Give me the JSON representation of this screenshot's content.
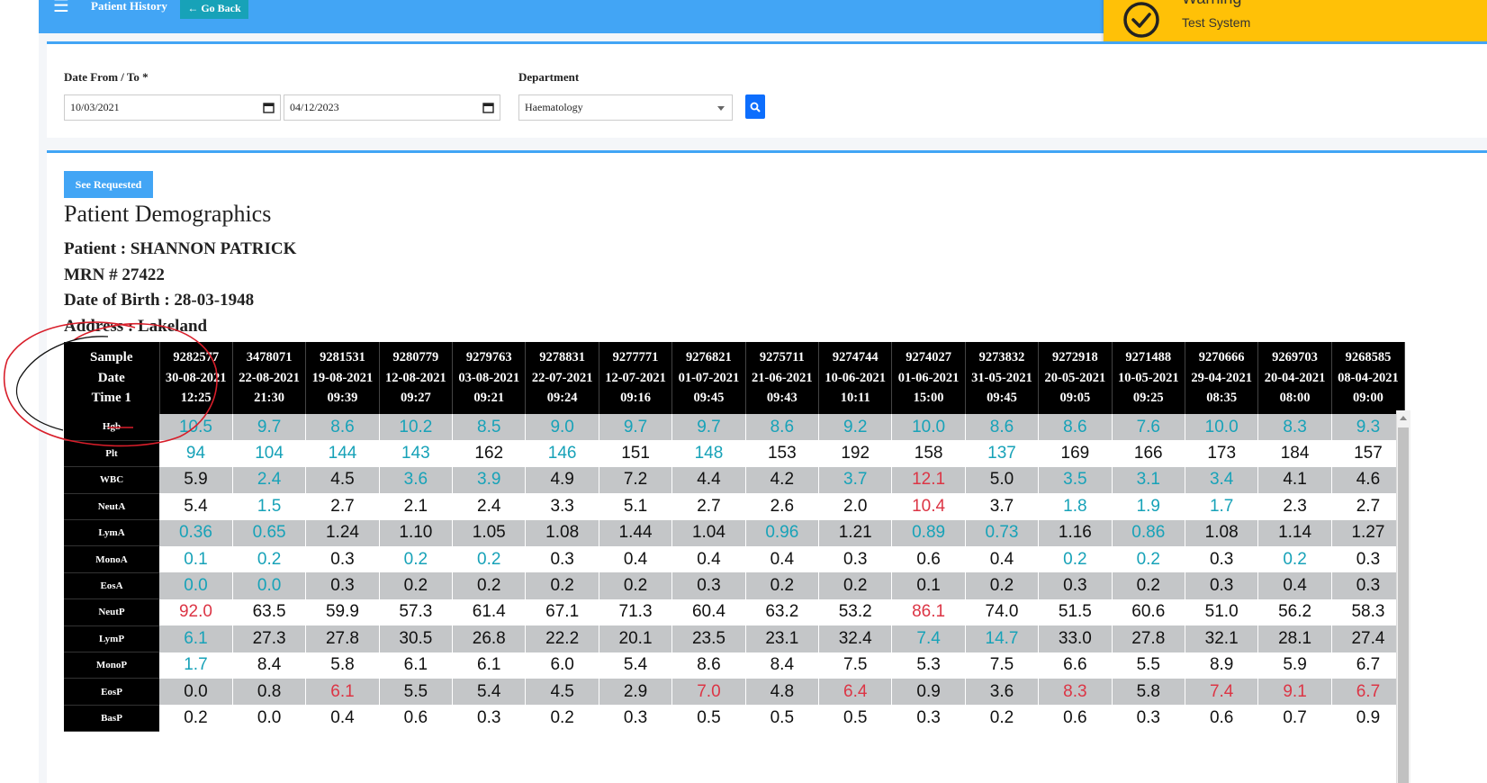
{
  "topbar": {
    "title": "Patient History",
    "go_back_label": "Go Back",
    "background": "#42a5f5"
  },
  "toast": {
    "title": "Warning",
    "message": "Test System",
    "icon": "check-circle-icon",
    "color": "#ffc107"
  },
  "filters": {
    "date_label": "Date From / To *",
    "date_from": "10/03/2021",
    "date_to": "04/12/2023",
    "department_label": "Department",
    "department_value": "Haematology"
  },
  "main": {
    "see_requested_label": "See Requested",
    "demographics_title": "Patient Demographics",
    "patient": "Patient : SHANNON PATRICK",
    "mrn": "MRN # 27422",
    "dob": "Date of Birth : 28-03-1948",
    "address": "Address : Lakeland"
  },
  "table": {
    "header": {
      "line1": "Sample",
      "line2": "Date",
      "line3": "Time 1"
    },
    "columns": [
      {
        "sample": "9282577",
        "date": "30-08-2021",
        "time": "12:25"
      },
      {
        "sample": "3478071",
        "date": "22-08-2021",
        "time": "21:30"
      },
      {
        "sample": "9281531",
        "date": "19-08-2021",
        "time": "09:39"
      },
      {
        "sample": "9280779",
        "date": "12-08-2021",
        "time": "09:27"
      },
      {
        "sample": "9279763",
        "date": "03-08-2021",
        "time": "09:21"
      },
      {
        "sample": "9278831",
        "date": "22-07-2021",
        "time": "09:24"
      },
      {
        "sample": "9277771",
        "date": "12-07-2021",
        "time": "09:16"
      },
      {
        "sample": "9276821",
        "date": "01-07-2021",
        "time": "09:45"
      },
      {
        "sample": "9275711",
        "date": "21-06-2021",
        "time": "09:43"
      },
      {
        "sample": "9274744",
        "date": "10-06-2021",
        "time": "10:11"
      },
      {
        "sample": "9274027",
        "date": "01-06-2021",
        "time": "15:00"
      },
      {
        "sample": "9273832",
        "date": "31-05-2021",
        "time": "09:45"
      },
      {
        "sample": "9272918",
        "date": "20-05-2021",
        "time": "09:05"
      },
      {
        "sample": "9271488",
        "date": "10-05-2021",
        "time": "09:25"
      },
      {
        "sample": "9270666",
        "date": "29-04-2021",
        "time": "08:35"
      },
      {
        "sample": "9269703",
        "date": "20-04-2021",
        "time": "08:00"
      },
      {
        "sample": "9268585",
        "date": "08-04-2021",
        "time": "09:00"
      }
    ],
    "status_colors": {
      "n": "#111111",
      "lo": "#17a2b8",
      "hi": "#dc3545"
    },
    "rows": [
      {
        "label": "Hgb",
        "cells": [
          [
            "10.5",
            "lo"
          ],
          [
            "9.7",
            "lo"
          ],
          [
            "8.6",
            "lo"
          ],
          [
            "10.2",
            "lo"
          ],
          [
            "8.5",
            "lo"
          ],
          [
            "9.0",
            "lo"
          ],
          [
            "9.7",
            "lo"
          ],
          [
            "9.7",
            "lo"
          ],
          [
            "8.6",
            "lo"
          ],
          [
            "9.2",
            "lo"
          ],
          [
            "10.0",
            "lo"
          ],
          [
            "8.6",
            "lo"
          ],
          [
            "8.6",
            "lo"
          ],
          [
            "7.6",
            "lo"
          ],
          [
            "10.0",
            "lo"
          ],
          [
            "8.3",
            "lo"
          ],
          [
            "9.3",
            "lo"
          ]
        ]
      },
      {
        "label": "Plt",
        "cells": [
          [
            "94",
            "lo"
          ],
          [
            "104",
            "lo"
          ],
          [
            "144",
            "lo"
          ],
          [
            "143",
            "lo"
          ],
          [
            "162",
            "n"
          ],
          [
            "146",
            "lo"
          ],
          [
            "151",
            "n"
          ],
          [
            "148",
            "lo"
          ],
          [
            "153",
            "n"
          ],
          [
            "192",
            "n"
          ],
          [
            "158",
            "n"
          ],
          [
            "137",
            "lo"
          ],
          [
            "169",
            "n"
          ],
          [
            "166",
            "n"
          ],
          [
            "173",
            "n"
          ],
          [
            "184",
            "n"
          ],
          [
            "157",
            "n"
          ]
        ]
      },
      {
        "label": "WBC",
        "cells": [
          [
            "5.9",
            "n"
          ],
          [
            "2.4",
            "lo"
          ],
          [
            "4.5",
            "n"
          ],
          [
            "3.6",
            "lo"
          ],
          [
            "3.9",
            "lo"
          ],
          [
            "4.9",
            "n"
          ],
          [
            "7.2",
            "n"
          ],
          [
            "4.4",
            "n"
          ],
          [
            "4.2",
            "n"
          ],
          [
            "3.7",
            "lo"
          ],
          [
            "12.1",
            "hi"
          ],
          [
            "5.0",
            "n"
          ],
          [
            "3.5",
            "lo"
          ],
          [
            "3.1",
            "lo"
          ],
          [
            "3.4",
            "lo"
          ],
          [
            "4.1",
            "n"
          ],
          [
            "4.6",
            "n"
          ]
        ]
      },
      {
        "label": "NeutA",
        "cells": [
          [
            "5.4",
            "n"
          ],
          [
            "1.5",
            "lo"
          ],
          [
            "2.7",
            "n"
          ],
          [
            "2.1",
            "n"
          ],
          [
            "2.4",
            "n"
          ],
          [
            "3.3",
            "n"
          ],
          [
            "5.1",
            "n"
          ],
          [
            "2.7",
            "n"
          ],
          [
            "2.6",
            "n"
          ],
          [
            "2.0",
            "n"
          ],
          [
            "10.4",
            "hi"
          ],
          [
            "3.7",
            "n"
          ],
          [
            "1.8",
            "lo"
          ],
          [
            "1.9",
            "lo"
          ],
          [
            "1.7",
            "lo"
          ],
          [
            "2.3",
            "n"
          ],
          [
            "2.7",
            "n"
          ]
        ]
      },
      {
        "label": "LymA",
        "cells": [
          [
            "0.36",
            "lo"
          ],
          [
            "0.65",
            "lo"
          ],
          [
            "1.24",
            "n"
          ],
          [
            "1.10",
            "n"
          ],
          [
            "1.05",
            "n"
          ],
          [
            "1.08",
            "n"
          ],
          [
            "1.44",
            "n"
          ],
          [
            "1.04",
            "n"
          ],
          [
            "0.96",
            "lo"
          ],
          [
            "1.21",
            "n"
          ],
          [
            "0.89",
            "lo"
          ],
          [
            "0.73",
            "lo"
          ],
          [
            "1.16",
            "n"
          ],
          [
            "0.86",
            "lo"
          ],
          [
            "1.08",
            "n"
          ],
          [
            "1.14",
            "n"
          ],
          [
            "1.27",
            "n"
          ]
        ]
      },
      {
        "label": "MonoA",
        "cells": [
          [
            "0.1",
            "lo"
          ],
          [
            "0.2",
            "lo"
          ],
          [
            "0.3",
            "n"
          ],
          [
            "0.2",
            "lo"
          ],
          [
            "0.2",
            "lo"
          ],
          [
            "0.3",
            "n"
          ],
          [
            "0.4",
            "n"
          ],
          [
            "0.4",
            "n"
          ],
          [
            "0.4",
            "n"
          ],
          [
            "0.3",
            "n"
          ],
          [
            "0.6",
            "n"
          ],
          [
            "0.4",
            "n"
          ],
          [
            "0.2",
            "lo"
          ],
          [
            "0.2",
            "lo"
          ],
          [
            "0.3",
            "n"
          ],
          [
            "0.2",
            "lo"
          ],
          [
            "0.3",
            "n"
          ]
        ]
      },
      {
        "label": "EosA",
        "cells": [
          [
            "0.0",
            "lo"
          ],
          [
            "0.0",
            "lo"
          ],
          [
            "0.3",
            "n"
          ],
          [
            "0.2",
            "n"
          ],
          [
            "0.2",
            "n"
          ],
          [
            "0.2",
            "n"
          ],
          [
            "0.2",
            "n"
          ],
          [
            "0.3",
            "n"
          ],
          [
            "0.2",
            "n"
          ],
          [
            "0.2",
            "n"
          ],
          [
            "0.1",
            "n"
          ],
          [
            "0.2",
            "n"
          ],
          [
            "0.3",
            "n"
          ],
          [
            "0.2",
            "n"
          ],
          [
            "0.3",
            "n"
          ],
          [
            "0.4",
            "n"
          ],
          [
            "0.3",
            "n"
          ]
        ]
      },
      {
        "label": "NeutP",
        "cells": [
          [
            "92.0",
            "hi"
          ],
          [
            "63.5",
            "n"
          ],
          [
            "59.9",
            "n"
          ],
          [
            "57.3",
            "n"
          ],
          [
            "61.4",
            "n"
          ],
          [
            "67.1",
            "n"
          ],
          [
            "71.3",
            "n"
          ],
          [
            "60.4",
            "n"
          ],
          [
            "63.2",
            "n"
          ],
          [
            "53.2",
            "n"
          ],
          [
            "86.1",
            "hi"
          ],
          [
            "74.0",
            "n"
          ],
          [
            "51.5",
            "n"
          ],
          [
            "60.6",
            "n"
          ],
          [
            "51.0",
            "n"
          ],
          [
            "56.2",
            "n"
          ],
          [
            "58.3",
            "n"
          ]
        ]
      },
      {
        "label": "LymP",
        "cells": [
          [
            "6.1",
            "lo"
          ],
          [
            "27.3",
            "n"
          ],
          [
            "27.8",
            "n"
          ],
          [
            "30.5",
            "n"
          ],
          [
            "26.8",
            "n"
          ],
          [
            "22.2",
            "n"
          ],
          [
            "20.1",
            "n"
          ],
          [
            "23.5",
            "n"
          ],
          [
            "23.1",
            "n"
          ],
          [
            "32.4",
            "n"
          ],
          [
            "7.4",
            "lo"
          ],
          [
            "14.7",
            "lo"
          ],
          [
            "33.0",
            "n"
          ],
          [
            "27.8",
            "n"
          ],
          [
            "32.1",
            "n"
          ],
          [
            "28.1",
            "n"
          ],
          [
            "27.4",
            "n"
          ]
        ]
      },
      {
        "label": "MonoP",
        "cells": [
          [
            "1.7",
            "lo"
          ],
          [
            "8.4",
            "n"
          ],
          [
            "5.8",
            "n"
          ],
          [
            "6.1",
            "n"
          ],
          [
            "6.1",
            "n"
          ],
          [
            "6.0",
            "n"
          ],
          [
            "5.4",
            "n"
          ],
          [
            "8.6",
            "n"
          ],
          [
            "8.4",
            "n"
          ],
          [
            "7.5",
            "n"
          ],
          [
            "5.3",
            "n"
          ],
          [
            "7.5",
            "n"
          ],
          [
            "6.6",
            "n"
          ],
          [
            "5.5",
            "n"
          ],
          [
            "8.9",
            "n"
          ],
          [
            "5.9",
            "n"
          ],
          [
            "6.7",
            "n"
          ]
        ]
      },
      {
        "label": "EosP",
        "cells": [
          [
            "0.0",
            "n"
          ],
          [
            "0.8",
            "n"
          ],
          [
            "6.1",
            "hi"
          ],
          [
            "5.5",
            "n"
          ],
          [
            "5.4",
            "n"
          ],
          [
            "4.5",
            "n"
          ],
          [
            "2.9",
            "n"
          ],
          [
            "7.0",
            "hi"
          ],
          [
            "4.8",
            "n"
          ],
          [
            "6.4",
            "hi"
          ],
          [
            "0.9",
            "n"
          ],
          [
            "3.6",
            "n"
          ],
          [
            "8.3",
            "hi"
          ],
          [
            "5.8",
            "n"
          ],
          [
            "7.4",
            "hi"
          ],
          [
            "9.1",
            "hi"
          ],
          [
            "6.7",
            "hi"
          ]
        ]
      },
      {
        "label": "BasP",
        "cells": [
          [
            "0.2",
            "n"
          ],
          [
            "0.0",
            "n"
          ],
          [
            "0.4",
            "n"
          ],
          [
            "0.6",
            "n"
          ],
          [
            "0.3",
            "n"
          ],
          [
            "0.2",
            "n"
          ],
          [
            "0.3",
            "n"
          ],
          [
            "0.5",
            "n"
          ],
          [
            "0.5",
            "n"
          ],
          [
            "0.5",
            "n"
          ],
          [
            "0.3",
            "n"
          ],
          [
            "0.2",
            "n"
          ],
          [
            "0.6",
            "n"
          ],
          [
            "0.3",
            "n"
          ],
          [
            "0.6",
            "n"
          ],
          [
            "0.7",
            "n"
          ],
          [
            "0.9",
            "n"
          ]
        ]
      }
    ]
  }
}
